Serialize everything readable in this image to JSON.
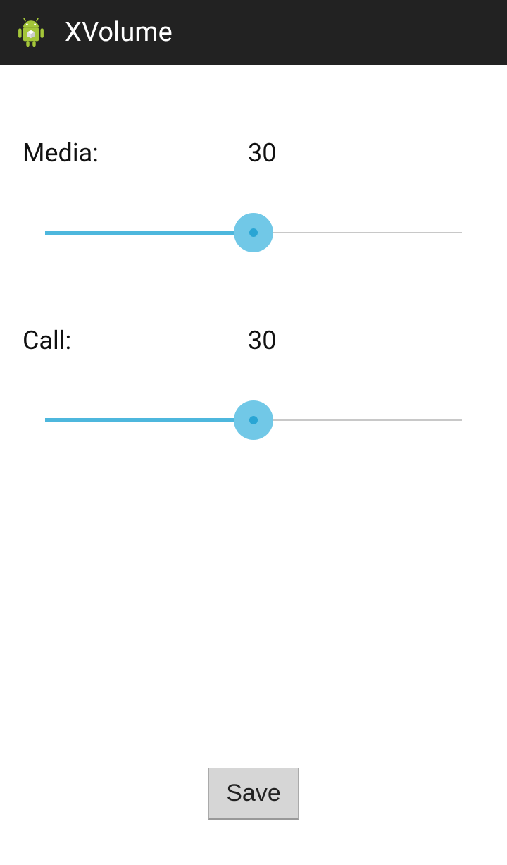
{
  "header": {
    "title": "XVolume"
  },
  "sliders": {
    "media": {
      "label": "Media:",
      "value": "30",
      "percent": 50
    },
    "call": {
      "label": "Call:",
      "value": "30",
      "percent": 50
    }
  },
  "buttons": {
    "save": "Save"
  },
  "colors": {
    "accent": "#4db7dd",
    "thumb": "#71c8e7",
    "thumb_center": "#29a5d4",
    "action_bar": "#222222"
  }
}
